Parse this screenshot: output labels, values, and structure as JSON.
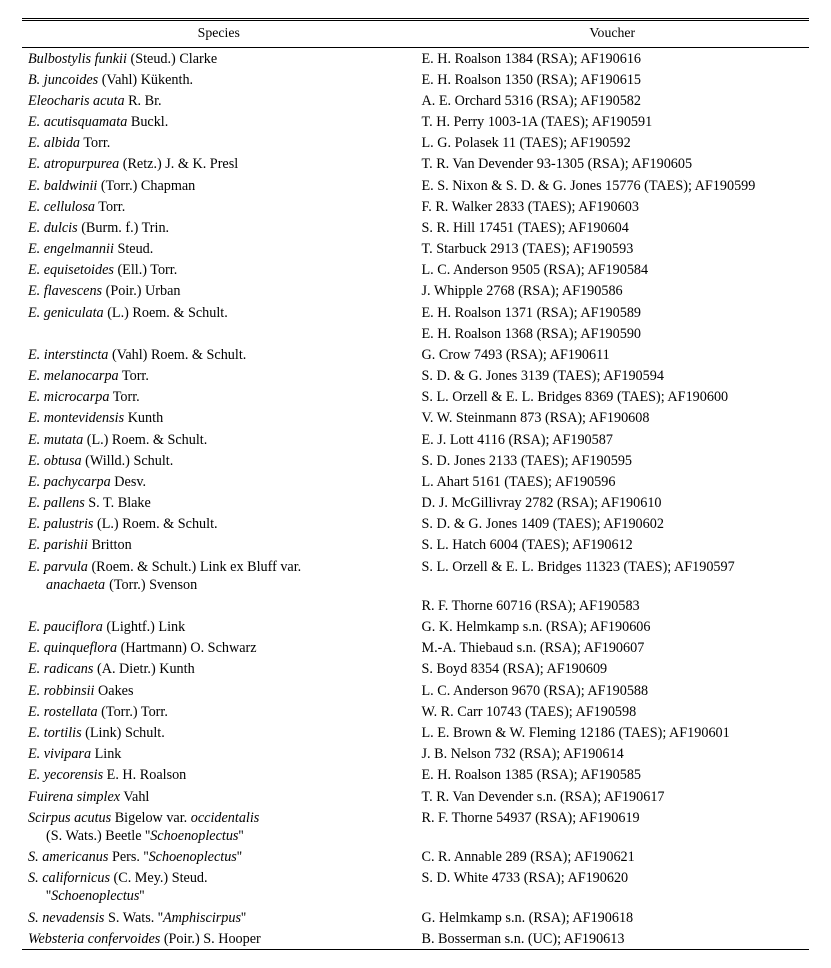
{
  "headers": {
    "species": "Species",
    "voucher": "Voucher"
  },
  "rows": [
    {
      "species": "<span class='nm'>Bulbostylis funkii</span> (Steud.) Clarke",
      "voucher": "E. H. Roalson 1384 (RSA); AF190616"
    },
    {
      "species": "<span class='nm'>B. juncoides</span> (Vahl) Kükenth.",
      "voucher": "E. H. Roalson 1350 (RSA); AF190615"
    },
    {
      "species": "<span class='nm'>Eleocharis acuta</span> R. Br.",
      "voucher": "A. E. Orchard 5316 (RSA); AF190582"
    },
    {
      "species": "<span class='nm'>E. acutisquamata</span> Buckl.",
      "voucher": "T. H. Perry 1003-1A (TAES); AF190591"
    },
    {
      "species": "<span class='nm'>E. albida</span> Torr.",
      "voucher": "L. G. Polasek 11 (TAES); AF190592"
    },
    {
      "species": "<span class='nm'>E. atropurpurea</span> (Retz.) J. & K. Presl",
      "voucher": "T. R. Van Devender 93-1305 (RSA); AF190605"
    },
    {
      "species": "<span class='nm'>E. baldwinii</span> (Torr.) Chapman",
      "voucher": "E. S. Nixon & S. D. & G. Jones 15776 (TAES); AF190599"
    },
    {
      "species": "<span class='nm'>E. cellulosa</span> Torr.",
      "voucher": "F. R. Walker 2833 (TAES); AF190603"
    },
    {
      "species": "<span class='nm'>E. dulcis</span> (Burm. f.) Trin.",
      "voucher": "S. R. Hill 17451 (TAES); AF190604"
    },
    {
      "species": "<span class='nm'>E. engelmannii</span> Steud.",
      "voucher": "T. Starbuck 2913 (TAES); AF190593"
    },
    {
      "species": "<span class='nm'>E. equisetoides</span> (Ell.) Torr.",
      "voucher": "L. C. Anderson 9505 (RSA); AF190584"
    },
    {
      "species": "<span class='nm'>E. flavescens</span> (Poir.) Urban",
      "voucher": "J. Whipple 2768 (RSA); AF190586"
    },
    {
      "species": "<span class='nm'>E. geniculata</span> (L.) Roem. & Schult.",
      "voucher": "E. H. Roalson 1371 (RSA); AF190589"
    },
    {
      "species": "",
      "voucher": "E. H. Roalson 1368 (RSA); AF190590"
    },
    {
      "species": "<span class='nm'>E. interstincta</span> (Vahl) Roem. & Schult.",
      "voucher": "G. Crow 7493 (RSA); AF190611"
    },
    {
      "species": "<span class='nm'>E. melanocarpa</span> Torr.",
      "voucher": "S. D. & G. Jones 3139 (TAES); AF190594"
    },
    {
      "species": "<span class='nm'>E. microcarpa</span> Torr.",
      "voucher": "S. L. Orzell & E. L. Bridges 8369 (TAES); AF190600"
    },
    {
      "species": "<span class='nm'>E. montevidensis</span> Kunth",
      "voucher": "V. W. Steinmann 873 (RSA); AF190608"
    },
    {
      "species": "<span class='nm'>E. mutata</span> (L.) Roem. & Schult.",
      "voucher": "E. J. Lott 4116 (RSA); AF190587"
    },
    {
      "species": "<span class='nm'>E. obtusa</span> (Willd.) Schult.",
      "voucher": "S. D. Jones 2133 (TAES); AF190595"
    },
    {
      "species": "<span class='nm'>E. pachycarpa</span> Desv.",
      "voucher": "L. Ahart 5161 (TAES); AF190596"
    },
    {
      "species": "<span class='nm'>E. pallens</span> S. T. Blake",
      "voucher": "D. J. McGillivray 2782 (RSA); AF190610"
    },
    {
      "species": "<span class='nm'>E. palustris</span> (L.) Roem. & Schult.",
      "voucher": "S. D. & G. Jones 1409 (TAES); AF190602"
    },
    {
      "species": "<span class='nm'>E. parishii</span> Britton",
      "voucher": "S. L. Hatch 6004 (TAES); AF190612"
    },
    {
      "species": "<span class='nm'>E. parvula</span> (Roem. & Schult.) Link ex Bluff var.<br><span class='indent nm'>anachaeta</span><span class='indent' style='padding-left:4px;font-style:normal'> (Torr.) Svenson</span>",
      "voucher": "S. L. Orzell & E. L. Bridges 11323 (TAES); AF190597"
    },
    {
      "species": "",
      "voucher": "R. F. Thorne 60716 (RSA); AF190583"
    },
    {
      "species": "<span class='nm'>E. pauciflora</span> (Lightf.) Link",
      "voucher": "G. K. Helmkamp s.n. (RSA); AF190606"
    },
    {
      "species": "<span class='nm'>E. quinqueflora</span> (Hartmann) O. Schwarz",
      "voucher": "M.-A. Thiebaud s.n. (RSA); AF190607"
    },
    {
      "species": "<span class='nm'>E. radicans</span> (A. Dietr.) Kunth",
      "voucher": "S. Boyd 8354 (RSA); AF190609"
    },
    {
      "species": "<span class='nm'>E. robbinsii</span> Oakes",
      "voucher": "L. C. Anderson 9670 (RSA); AF190588"
    },
    {
      "species": "<span class='nm'>E. rostellata</span> (Torr.) Torr.",
      "voucher": "W. R. Carr 10743 (TAES); AF190598"
    },
    {
      "species": "<span class='nm'>E. tortilis</span> (Link) Schult.",
      "voucher": "L. E. Brown & W. Fleming 12186 (TAES); AF190601"
    },
    {
      "species": "<span class='nm'>E. vivipara</span> Link",
      "voucher": "J. B. Nelson 732 (RSA); AF190614"
    },
    {
      "species": "<span class='nm'>E. yecorensis</span> E. H. Roalson",
      "voucher": "E. H. Roalson 1385 (RSA); AF190585"
    },
    {
      "species": "<span class='nm'>Fuirena simplex</span> Vahl",
      "voucher": "T. R. Van Devender s.n. (RSA); AF190617"
    },
    {
      "species": "<span class='nm'>Scirpus acutus</span> Bigelow var. <span class='nm'>occidentalis</span><br><span class='indent'>(S. Wats.) Beetle ''<span class='nm'>Schoenoplectus</span>''</span>",
      "voucher": "R. F. Thorne 54937 (RSA); AF190619"
    },
    {
      "species": "<span class='nm'>S. americanus</span> Pers. ''<span class='nm'>Schoenoplectus</span>''",
      "voucher": "C. R. Annable 289 (RSA); AF190621"
    },
    {
      "species": "<span class='nm'>S. californicus</span> (C. Mey.) Steud.<br><span class='indent'>''<span class='nm'>Schoenoplectus</span>''</span>",
      "voucher": "S. D. White 4733 (RSA); AF190620"
    },
    {
      "species": "<span class='nm'>S. nevadensis</span> S. Wats. ''<span class='nm'>Amphiscirpus</span>''",
      "voucher": "G. Helmkamp s.n. (RSA); AF190618"
    },
    {
      "species": "<span class='nm'>Websteria confervoides</span> (Poir.) S. Hooper",
      "voucher": "B. Bosserman s.n. (UC); AF190613"
    }
  ]
}
